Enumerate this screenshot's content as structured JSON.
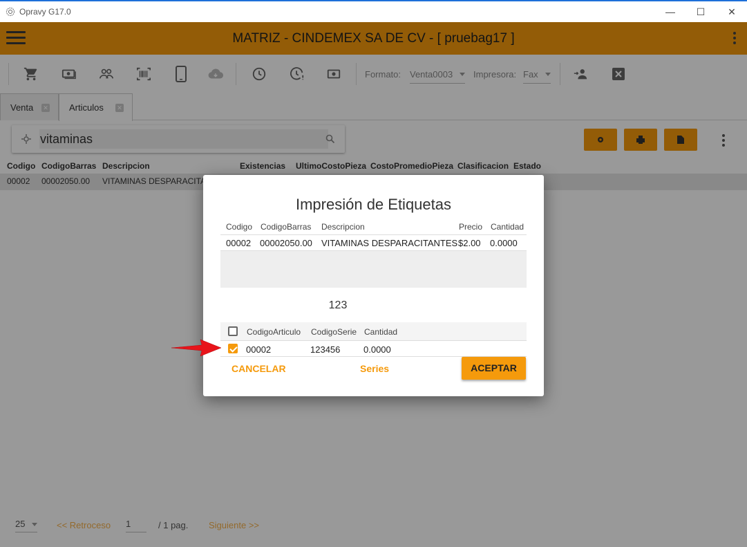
{
  "window": {
    "title": "Opravy G17.0",
    "minimize": "—",
    "maximize": "☐",
    "close": "✕"
  },
  "appbar": {
    "title": "MATRIZ - CINDEMEX SA DE CV - [ pruebag17 ]"
  },
  "toolbar": {
    "formato_label": "Formato:",
    "formato_value": "Venta0003",
    "impresora_label": "Impresora:",
    "impresora_value": "Fax"
  },
  "tabs": [
    {
      "label": "Venta"
    },
    {
      "label": "Articulos"
    }
  ],
  "search": {
    "value": "vitaminas"
  },
  "grid": {
    "headers": [
      "Codigo",
      "CodigoBarras",
      "Descripcion",
      "Existencias",
      "UltimoCostoPieza",
      "CostoPromedioPieza",
      "Clasificacion",
      "Estado"
    ],
    "row": [
      "00002",
      "00002050.00",
      "VITAMINAS DESPARACITANTES"
    ]
  },
  "pager": {
    "page_size": "25",
    "prev": "<<  Retroceso",
    "page": "1",
    "of": "/  1  pag.",
    "next": "Siguiente  >>"
  },
  "dialog": {
    "title": "Impresión de Etiquetas",
    "table1": {
      "headers": [
        "Codigo",
        "CodigoBarras",
        "Descripcion",
        "Precio",
        "Cantidad"
      ],
      "row": [
        "00002",
        "00002050.00",
        "VITAMINAS DESPARACITANTES",
        "$2.00",
        "0.0000"
      ]
    },
    "number": "123",
    "table2": {
      "headers": [
        "CodigoArticulo",
        "CodigoSerie",
        "Cantidad"
      ],
      "row": [
        "00002",
        "123456",
        "0.0000"
      ]
    },
    "buttons": {
      "cancel": "CANCELAR",
      "series": "Series",
      "accept": "ACEPTAR"
    }
  },
  "colors": {
    "accent": "#f59a0c",
    "arrow": "#e8141b"
  }
}
